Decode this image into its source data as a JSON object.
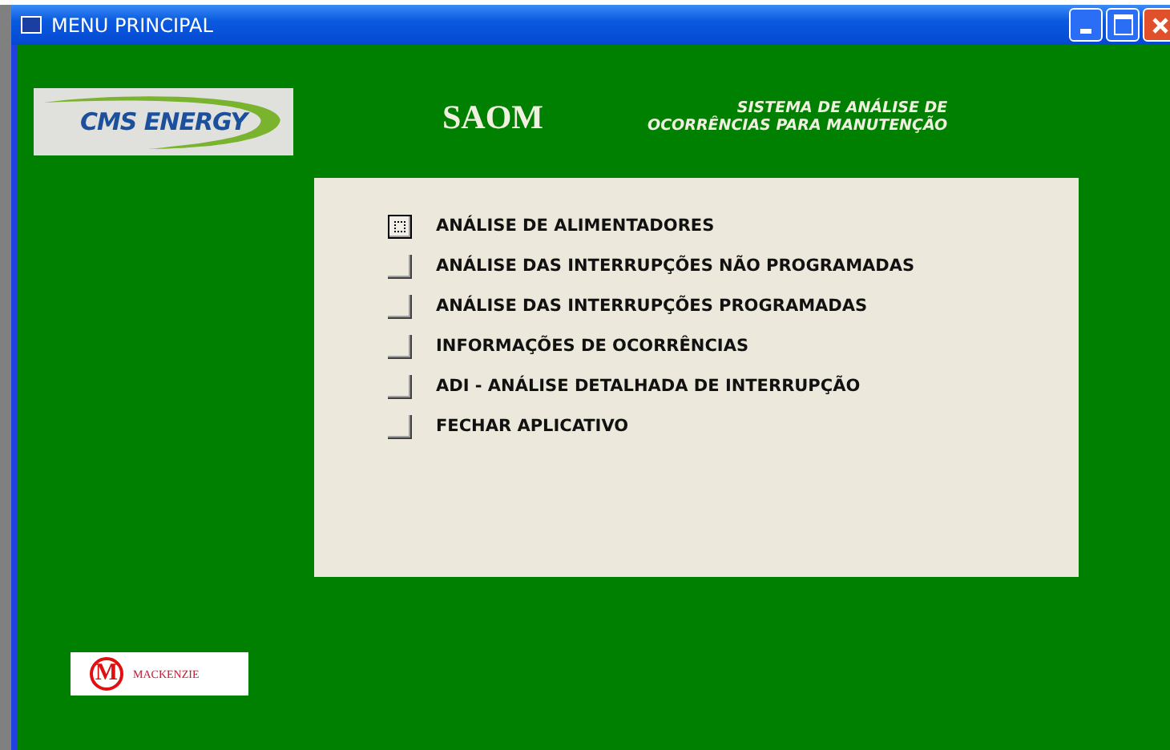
{
  "window": {
    "title": "MENU PRINCIPAL"
  },
  "header": {
    "logo": "CMS ENERGY",
    "app_name": "SAOM",
    "subtitle_lines": [
      "SISTEMA DE ANÁLISE DE",
      "OCORRÊNCIAS PARA MANUTENÇÃO"
    ]
  },
  "menu": [
    {
      "label": "ANÁLISE DE ALIMENTADORES",
      "focused": true
    },
    {
      "label": "ANÁLISE DAS INTERRUPÇÕES NÃO PROGRAMADAS",
      "focused": false
    },
    {
      "label": "ANÁLISE DAS INTERRUPÇÕES PROGRAMADAS",
      "focused": false
    },
    {
      "label": "INFORMAÇÕES DE OCORRÊNCIAS",
      "focused": false
    },
    {
      "label": "ADI - ANÁLISE DETALHADA DE INTERRUPÇÃO",
      "focused": false
    },
    {
      "label": "FECHAR APLICATIVO",
      "focused": false
    }
  ],
  "footer_logo": {
    "mark": "M",
    "name": "MACKENZIE"
  }
}
